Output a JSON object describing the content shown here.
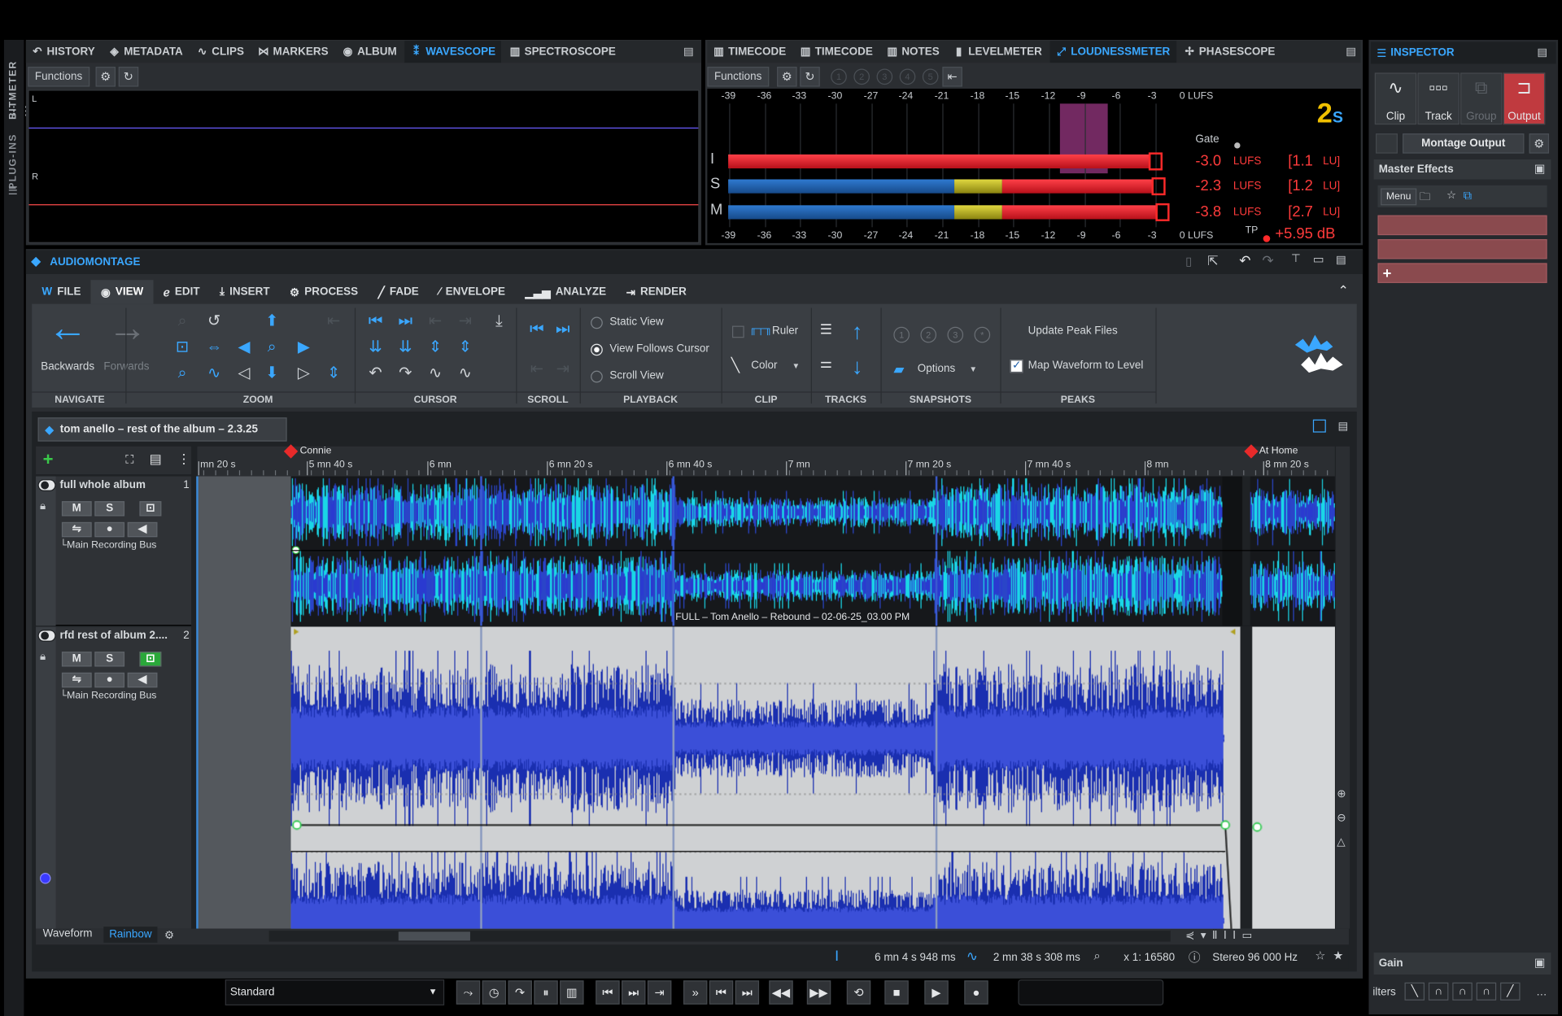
{
  "side_tabs": {
    "bitmeter": "BITMETER",
    "plugins": "PLUG-INS"
  },
  "top_left_tabs": [
    "HISTORY",
    "METADATA",
    "CLIPS",
    "MARKERS",
    "ALBUM",
    "WAVESCOPE",
    "SPECTROSCOPE"
  ],
  "top_left_active": "WAVESCOPE",
  "wavescope": {
    "functions_label": "Functions",
    "channel_left": "L",
    "channel_right": "R"
  },
  "top_right_tabs": [
    "TIMECODE",
    "TIMECODE",
    "NOTES",
    "LEVELMETER",
    "LOUDNESSMETER",
    "PHASESCOPE"
  ],
  "top_right_active": "LOUDNESSMETER",
  "loudness": {
    "functions_label": "Functions",
    "presets": [
      "1",
      "2",
      "3",
      "4",
      "5"
    ],
    "scale": [
      "-39",
      "-36",
      "-33",
      "-30",
      "-27",
      "-24",
      "-21",
      "-18",
      "-15",
      "-12",
      "-9",
      "-6",
      "-3",
      "0 LUFS"
    ],
    "gate_label": "Gate",
    "rows": [
      {
        "label": "I",
        "value": "-3.0",
        "unit": "LUFS",
        "lu": "[1.1",
        "lu_unit": "LU]"
      },
      {
        "label": "S",
        "value": "-2.3",
        "unit": "LUFS",
        "lu": "[1.2",
        "lu_unit": "LU]"
      },
      {
        "label": "M",
        "value": "-3.8",
        "unit": "LUFS",
        "lu": "[2.7",
        "lu_unit": "LU]"
      }
    ],
    "tp_label": "TP",
    "tp_value": "+5.95 dB",
    "colors": {
      "red": "#e8202a",
      "blue": "#1f5ea8",
      "yellow": "#c8c020",
      "gate": "#a23a8a"
    }
  },
  "inspector": {
    "title": "INSPECTOR",
    "tabs": [
      "Clip",
      "Track",
      "Group",
      "Output"
    ],
    "active_tab": "Output",
    "montage_output": "Montage Output",
    "master_effects": "Master Effects",
    "menu_label": "Menu",
    "gain_label": "Gain",
    "filters_label": "ilters"
  },
  "montage": {
    "title": "AUDIOMONTAGE",
    "ribbon_tabs": [
      "FILE",
      "VIEW",
      "EDIT",
      "INSERT",
      "PROCESS",
      "FADE",
      "ENVELOPE",
      "ANALYZE",
      "RENDER"
    ],
    "ribbon_active": "VIEW",
    "navigate": {
      "backwards": "Backwards",
      "forwards": "Forwards"
    },
    "groups": [
      "NAVIGATE",
      "ZOOM",
      "CURSOR",
      "SCROLL",
      "PLAYBACK",
      "CLIP",
      "TRACKS",
      "SNAPSHOTS",
      "PEAKS"
    ],
    "playback": {
      "static_view": "Static View",
      "view_follows_cursor": "View Follows Cursor",
      "scroll_view": "Scroll View",
      "selected": "View Follows Cursor"
    },
    "clip": {
      "ruler": "Ruler",
      "color": "Color"
    },
    "snapshots": {
      "options": "Options",
      "slots": [
        "1",
        "2",
        "3",
        "*"
      ]
    },
    "peaks": {
      "update": "Update Peak Files",
      "map": "Map Waveform to Level",
      "map_checked": true
    },
    "doc_tab": "tom anello – rest of the album – 2.3.25",
    "markers": {
      "start": "Connie",
      "end": "At Home"
    },
    "ruler": [
      "mn 20 s",
      "5 mn 40 s",
      "6 mn",
      "6 mn 20 s",
      "6 mn 40 s",
      "7 mn",
      "7 mn 20 s",
      "7 mn 40 s",
      "8 mn",
      "8 mn 20 s"
    ],
    "tracks": [
      {
        "name": "full whole album",
        "index": "1",
        "mute": "M",
        "solo": "S",
        "bus": "└Main Recording Bus"
      },
      {
        "name": "rfd rest of album 2....",
        "index": "2",
        "mute": "M",
        "solo": "S",
        "bus": "└Main Recording Bus"
      }
    ],
    "clip_caption": "FULL – Tom Anello – Rebound – 02-06-25_03.00 PM",
    "bottom_tabs": [
      "Waveform",
      "Rainbow"
    ],
    "bottom_active": "Rainbow",
    "status": {
      "position": "6 mn 4 s 948 ms",
      "length": "2 mn 38 s 308 ms",
      "zoom": "x 1: 16580",
      "format": "Stereo 96 000 Hz"
    }
  },
  "transport": {
    "preset": "Standard"
  },
  "colors": {
    "accent": "#3aa7ff",
    "waveform": "#2a45c8",
    "waveform_peak": "#1ad6e6",
    "output_active": "#c03a3f"
  }
}
